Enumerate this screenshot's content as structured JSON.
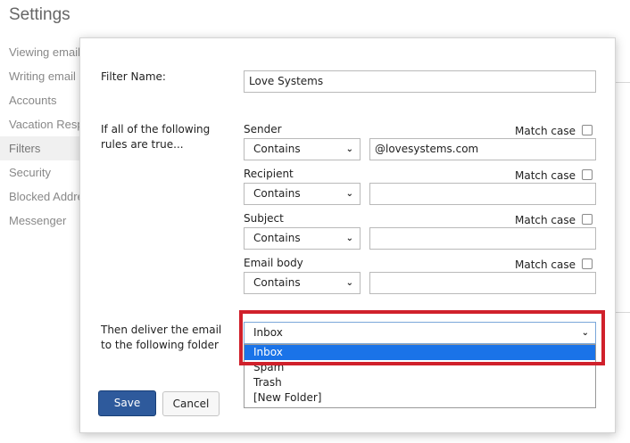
{
  "page": {
    "title": "Settings"
  },
  "sidebar": {
    "items": [
      {
        "label": "Viewing email"
      },
      {
        "label": "Writing email"
      },
      {
        "label": "Accounts"
      },
      {
        "label": "Vacation Resp"
      },
      {
        "label": "Filters"
      },
      {
        "label": "Security"
      },
      {
        "label": "Blocked Addre"
      },
      {
        "label": "Messenger"
      }
    ]
  },
  "dialog": {
    "filter_name_label": "Filter Name:",
    "filter_name_value": "Love Systems",
    "rules_label": "If all of the following rules are true...",
    "match_case_label": "Match case",
    "rules": [
      {
        "field": "Sender",
        "operator": "Contains",
        "value": "@lovesystems.com",
        "match_case": false
      },
      {
        "field": "Recipient",
        "operator": "Contains",
        "value": "",
        "match_case": false
      },
      {
        "field": "Subject",
        "operator": "Contains",
        "value": "",
        "match_case": false
      },
      {
        "field": "Email body",
        "operator": "Contains",
        "value": "",
        "match_case": false
      }
    ],
    "deliver_label": "Then deliver the email to the following folder",
    "folder": {
      "selected": "Inbox",
      "options": [
        "Inbox",
        "Spam",
        "Trash",
        "[New Folder]"
      ]
    },
    "save_label": "Save",
    "cancel_label": "Cancel"
  },
  "colors": {
    "highlight_box": "#d0202b",
    "save_button": "#2e5a9c",
    "selected_option": "#1a73e8"
  }
}
